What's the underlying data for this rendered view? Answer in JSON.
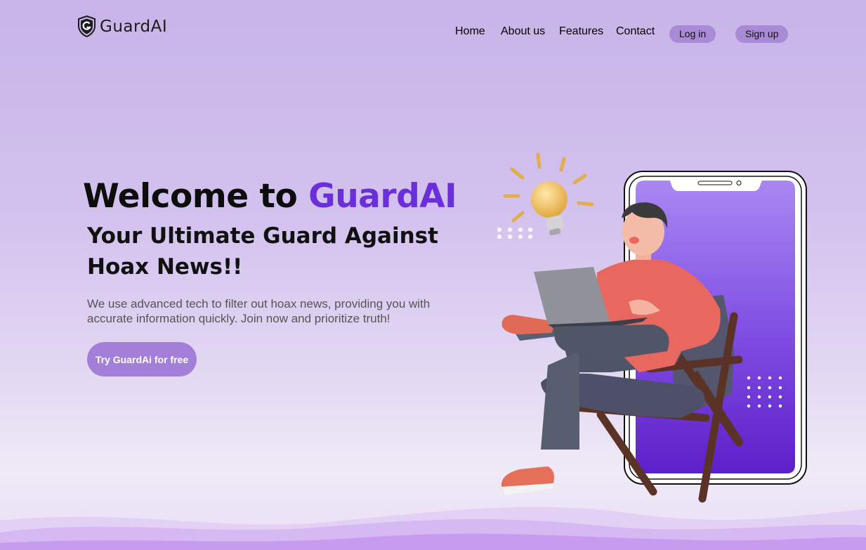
{
  "brand": {
    "name": "GuardAI",
    "logo_icon": "shield-g-icon"
  },
  "nav": {
    "links": [
      "Home",
      "About us",
      "Features",
      "Contact"
    ],
    "login_label": "Log in",
    "signup_label": "Sign up"
  },
  "hero": {
    "title_prefix": "Welcome to ",
    "title_brand": "GuardAI",
    "subtitle": "Your Ultimate Guard Against Hoax News!!",
    "description": "We use advanced tech to filter out hoax news, providing you with accurate information quickly. Join now and prioritize truth!",
    "cta_label": "Try GuardAi for free"
  },
  "colors": {
    "accent": "#6a2fd8",
    "button": "#a37fd9",
    "nav_pill": "#a98ad6",
    "phone_screen": "#7b3fe0"
  },
  "illustration": {
    "name": "person-on-chair-with-laptop",
    "icons": [
      "lightbulb-icon",
      "smartphone-icon",
      "laptop-icon"
    ]
  }
}
